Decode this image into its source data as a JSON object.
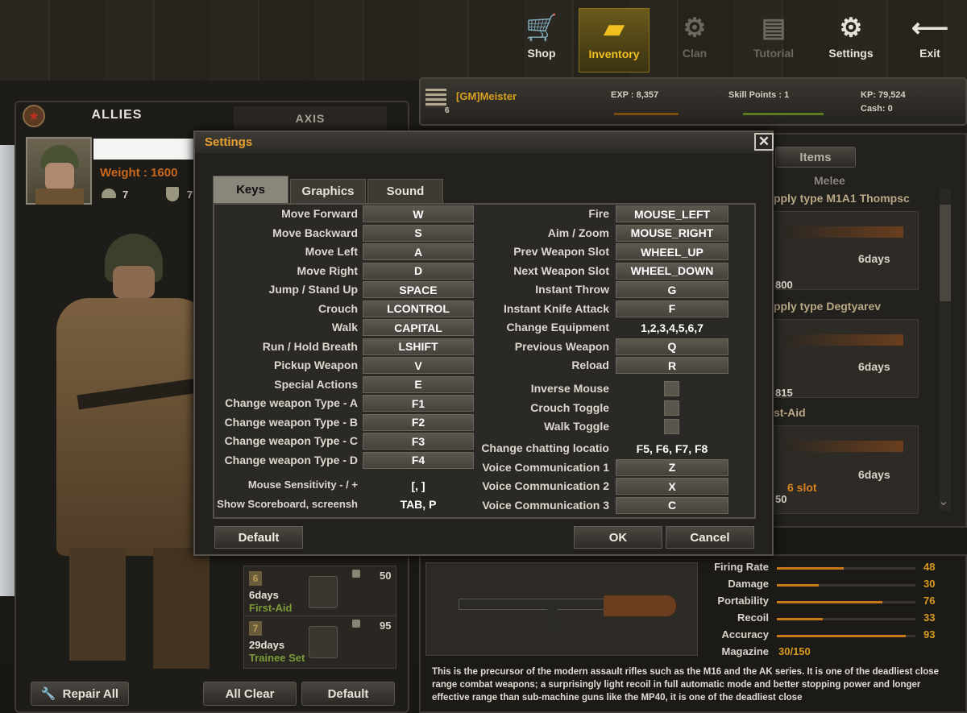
{
  "nav": [
    {
      "label": "Shop",
      "icon": "cart-icon"
    },
    {
      "label": "Inventory",
      "icon": "pistol-icon"
    },
    {
      "label": "Clan",
      "icon": "clan-icon"
    },
    {
      "label": "Tutorial",
      "icon": "clipboard-icon"
    },
    {
      "label": "Settings",
      "icon": "gear-icon"
    },
    {
      "label": "Exit",
      "icon": "arrow-left-icon"
    }
  ],
  "player": {
    "name": "[GM]Meister",
    "rank": "6",
    "exp": "EXP : 8,357",
    "skill_points": "Skill Points : 1",
    "kp": "KP: 79,524",
    "cash": "Cash: 0"
  },
  "teams": {
    "allies": "ALLIES",
    "axis": "AXIS"
  },
  "character": {
    "weight": "Weight : 1600",
    "stat1": "7",
    "stat2": "7"
  },
  "slots": [
    {
      "num": "6",
      "days": "6days",
      "name": "First-Aid",
      "count": "50"
    },
    {
      "num": "7",
      "days": "29days",
      "name": "Trainee Set",
      "count": "95"
    }
  ],
  "left_buttons": {
    "repair": "Repair All",
    "clear": "All Clear",
    "default": "Default"
  },
  "items_panel": {
    "tab": "Items",
    "sub": "Melee",
    "cards": [
      {
        "title": "pply type M1A1 Thompsc",
        "days": "6days",
        "value": "800"
      },
      {
        "title": "pply type Degtyarev",
        "days": "6days",
        "value": "815"
      },
      {
        "title": "st-Aid",
        "days": "6days",
        "slot": "6 slot",
        "value": "50"
      }
    ]
  },
  "weapon_stats": {
    "rows": [
      {
        "label": "Firing Rate",
        "value": 48
      },
      {
        "label": "Damage",
        "value": 30
      },
      {
        "label": "Portability",
        "value": 76
      },
      {
        "label": "Recoil",
        "value": 33
      },
      {
        "label": "Accuracy",
        "value": 93
      }
    ],
    "magazine_label": "Magazine",
    "magazine_value": "30/150",
    "description": "This is the precursor of the modern assault rifles such as the M16 and the AK series. It is one of the deadliest close range combat weapons; a surprisingly light recoil in full automatic mode and better stopping power and longer effective range than sub-machine guns like the MP40, it is one of the deadliest close"
  },
  "dialog": {
    "title": "Settings",
    "tabs": [
      "Keys",
      "Graphics",
      "Sound"
    ],
    "left_keys": [
      {
        "label": "Move Forward",
        "key": "W",
        "boxed": true
      },
      {
        "label": "Move Backward",
        "key": "S",
        "boxed": true
      },
      {
        "label": "Move Left",
        "key": "A",
        "boxed": true
      },
      {
        "label": "Move Right",
        "key": "D",
        "boxed": true
      },
      {
        "label": "Jump / Stand Up",
        "key": "SPACE",
        "boxed": true
      },
      {
        "label": "Crouch",
        "key": "LCONTROL",
        "boxed": true
      },
      {
        "label": "Walk",
        "key": "CAPITAL",
        "boxed": true
      },
      {
        "label": "Run / Hold Breath",
        "key": "LSHIFT",
        "boxed": true
      },
      {
        "label": "Pickup Weapon",
        "key": "V",
        "boxed": true
      },
      {
        "label": "Special Actions",
        "key": "E",
        "boxed": true
      },
      {
        "label": "Change weapon Type - A",
        "key": "F1",
        "boxed": true
      },
      {
        "label": "Change weapon Type - B",
        "key": "F2",
        "boxed": true
      },
      {
        "label": "Change weapon Type - C",
        "key": "F3",
        "boxed": true
      },
      {
        "label": "Change weapon Type - D",
        "key": "F4",
        "boxed": true
      }
    ],
    "left_extra": [
      {
        "label": "Mouse Sensitivity - / +",
        "key": "[, ]"
      },
      {
        "label": "Show Scoreboard, screensh",
        "key": "TAB, P"
      }
    ],
    "right_keys": [
      {
        "label": "Fire",
        "key": "MOUSE_LEFT",
        "boxed": true
      },
      {
        "label": "Aim / Zoom",
        "key": "MOUSE_RIGHT",
        "boxed": true
      },
      {
        "label": "Prev Weapon Slot",
        "key": "WHEEL_UP",
        "boxed": true
      },
      {
        "label": "Next Weapon Slot",
        "key": "WHEEL_DOWN",
        "boxed": true
      },
      {
        "label": "Instant Throw",
        "key": "G",
        "boxed": true
      },
      {
        "label": "Instant Knife Attack",
        "key": "F",
        "boxed": true
      },
      {
        "label": "Change Equipment",
        "key": "1,2,3,4,5,6,7",
        "boxed": false
      },
      {
        "label": "Previous Weapon",
        "key": "Q",
        "boxed": true
      },
      {
        "label": "Reload",
        "key": "R",
        "boxed": true
      }
    ],
    "toggles": [
      "Inverse Mouse",
      "Crouch Toggle",
      "Walk Toggle"
    ],
    "right_extra": [
      {
        "label": "Change chatting locatio",
        "key": "F5, F6, F7, F8",
        "boxed": false
      },
      {
        "label": "Voice Communication 1",
        "key": "Z",
        "boxed": true
      },
      {
        "label": "Voice Communication 2",
        "key": "X",
        "boxed": true
      },
      {
        "label": "Voice Communication 3",
        "key": "C",
        "boxed": true
      }
    ],
    "buttons": {
      "default": "Default",
      "ok": "OK",
      "cancel": "Cancel"
    }
  }
}
